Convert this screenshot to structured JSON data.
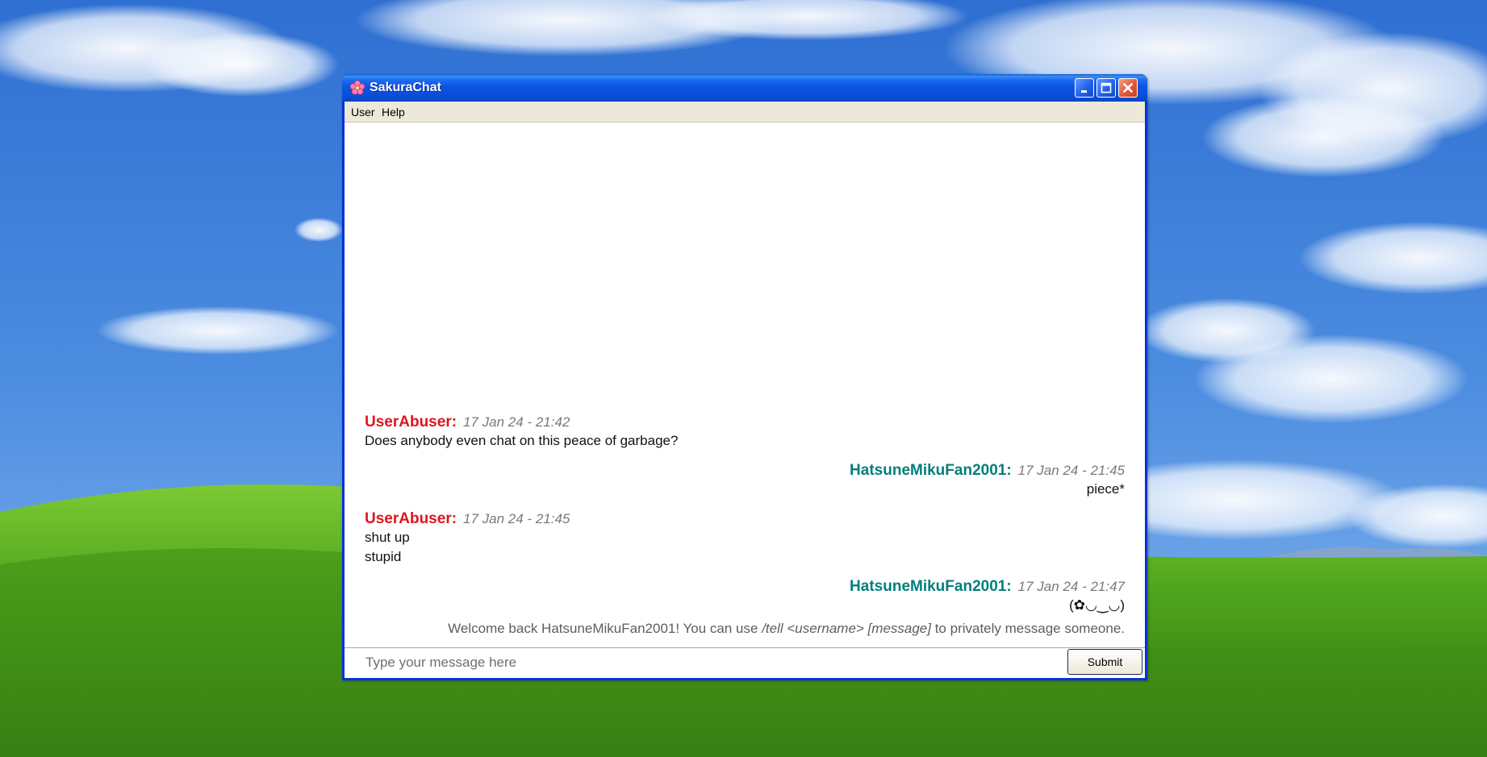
{
  "window": {
    "title": "SakuraChat"
  },
  "menu": {
    "items": [
      "User",
      "Help"
    ]
  },
  "messages": [
    {
      "sender": "UserAbuser:",
      "timestamp": "17 Jan 24 - 21:42",
      "lines": [
        "Does anybody even chat on this peace of garbage?"
      ],
      "color": "#e0141e"
    },
    {
      "sender": "HatsuneMikuFan2001:",
      "timestamp": "17 Jan 24 - 21:45",
      "lines": [
        "piece*"
      ],
      "color": "#007f7a"
    },
    {
      "sender": "UserAbuser:",
      "timestamp": "17 Jan 24 - 21:45",
      "lines": [
        "shut up",
        "stupid"
      ],
      "color": "#e0141e"
    },
    {
      "sender": "HatsuneMikuFan2001:",
      "timestamp": "17 Jan 24 - 21:47",
      "lines": [
        "(✿◡‿◡)"
      ],
      "color": "#007f7a"
    }
  ],
  "system_message": {
    "prefix": "Welcome back HatsuneMikuFan2001! You can use ",
    "command": "/tell <username> [message]",
    "suffix": " to privately message someone."
  },
  "composer": {
    "placeholder": "Type your message here",
    "value": "",
    "submit_label": "Submit"
  },
  "icons": {
    "app": "sakura-flower-icon",
    "minimize": "minimize-icon",
    "maximize": "maximize-icon",
    "close": "close-icon"
  },
  "colors": {
    "titlebar": "#0a55e0",
    "user_abuser": "#e0141e",
    "hatsune": "#007f7a",
    "menubar": "#ece9d8"
  }
}
